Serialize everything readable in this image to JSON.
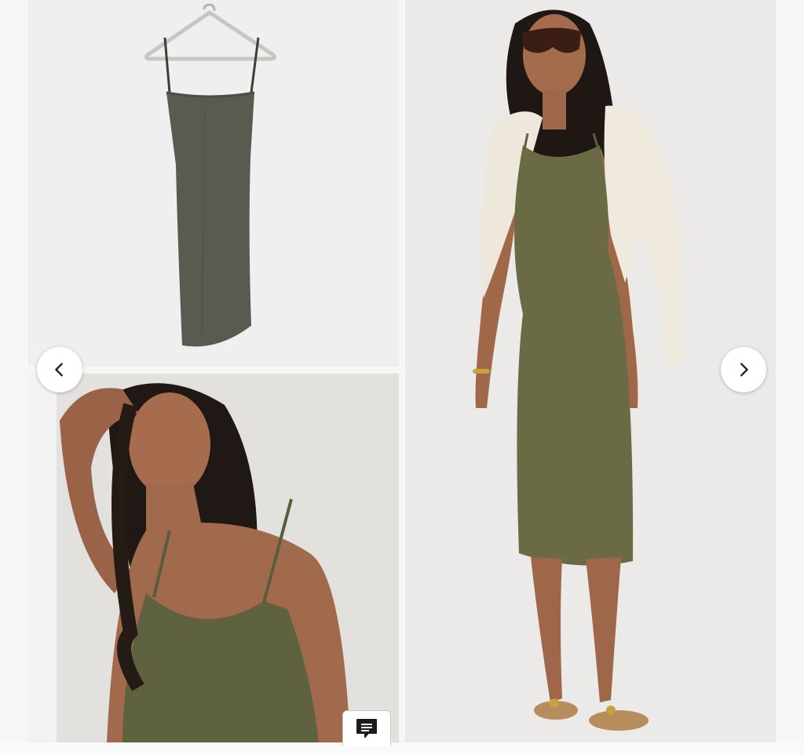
{
  "gallery": {
    "images": [
      {
        "name": "dress-on-hanger",
        "color": "#5c5f52"
      },
      {
        "name": "model-closeup",
        "color": "#5e6240"
      },
      {
        "name": "model-full-length",
        "color": "#6b6c43"
      }
    ],
    "prev_icon": "chevron-left-icon",
    "next_icon": "chevron-right-icon"
  },
  "chat": {
    "icon": "chat-icon"
  },
  "colors": {
    "dress": "#6a6b45",
    "jacket": "#efe9de",
    "skin": "#a26a4c",
    "hair": "#1e1713",
    "background": "#eeeeee"
  }
}
